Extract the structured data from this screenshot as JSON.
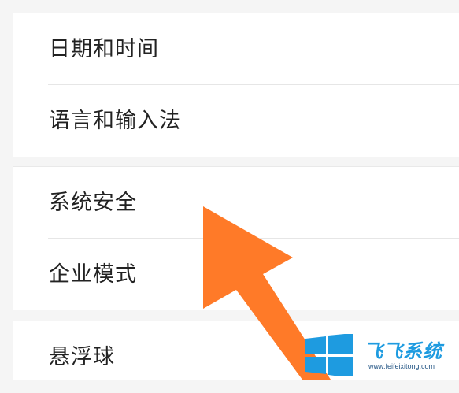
{
  "settings": {
    "groups": [
      {
        "items": [
          {
            "label": "日期和时间"
          },
          {
            "label": "语言和输入法"
          }
        ]
      },
      {
        "items": [
          {
            "label": "系统安全"
          },
          {
            "label": "企业模式"
          }
        ]
      },
      {
        "items": [
          {
            "label": "悬浮球"
          }
        ]
      }
    ]
  },
  "overlay": {
    "arrow_icon": "arrow-up-left-icon",
    "arrow_color": "#ff7a28"
  },
  "watermark": {
    "logo_icon": "windows-logo-icon",
    "brand_text": "飞飞系统",
    "url": "www.feifeixitong.com",
    "brand_color": "#1e9be0"
  }
}
